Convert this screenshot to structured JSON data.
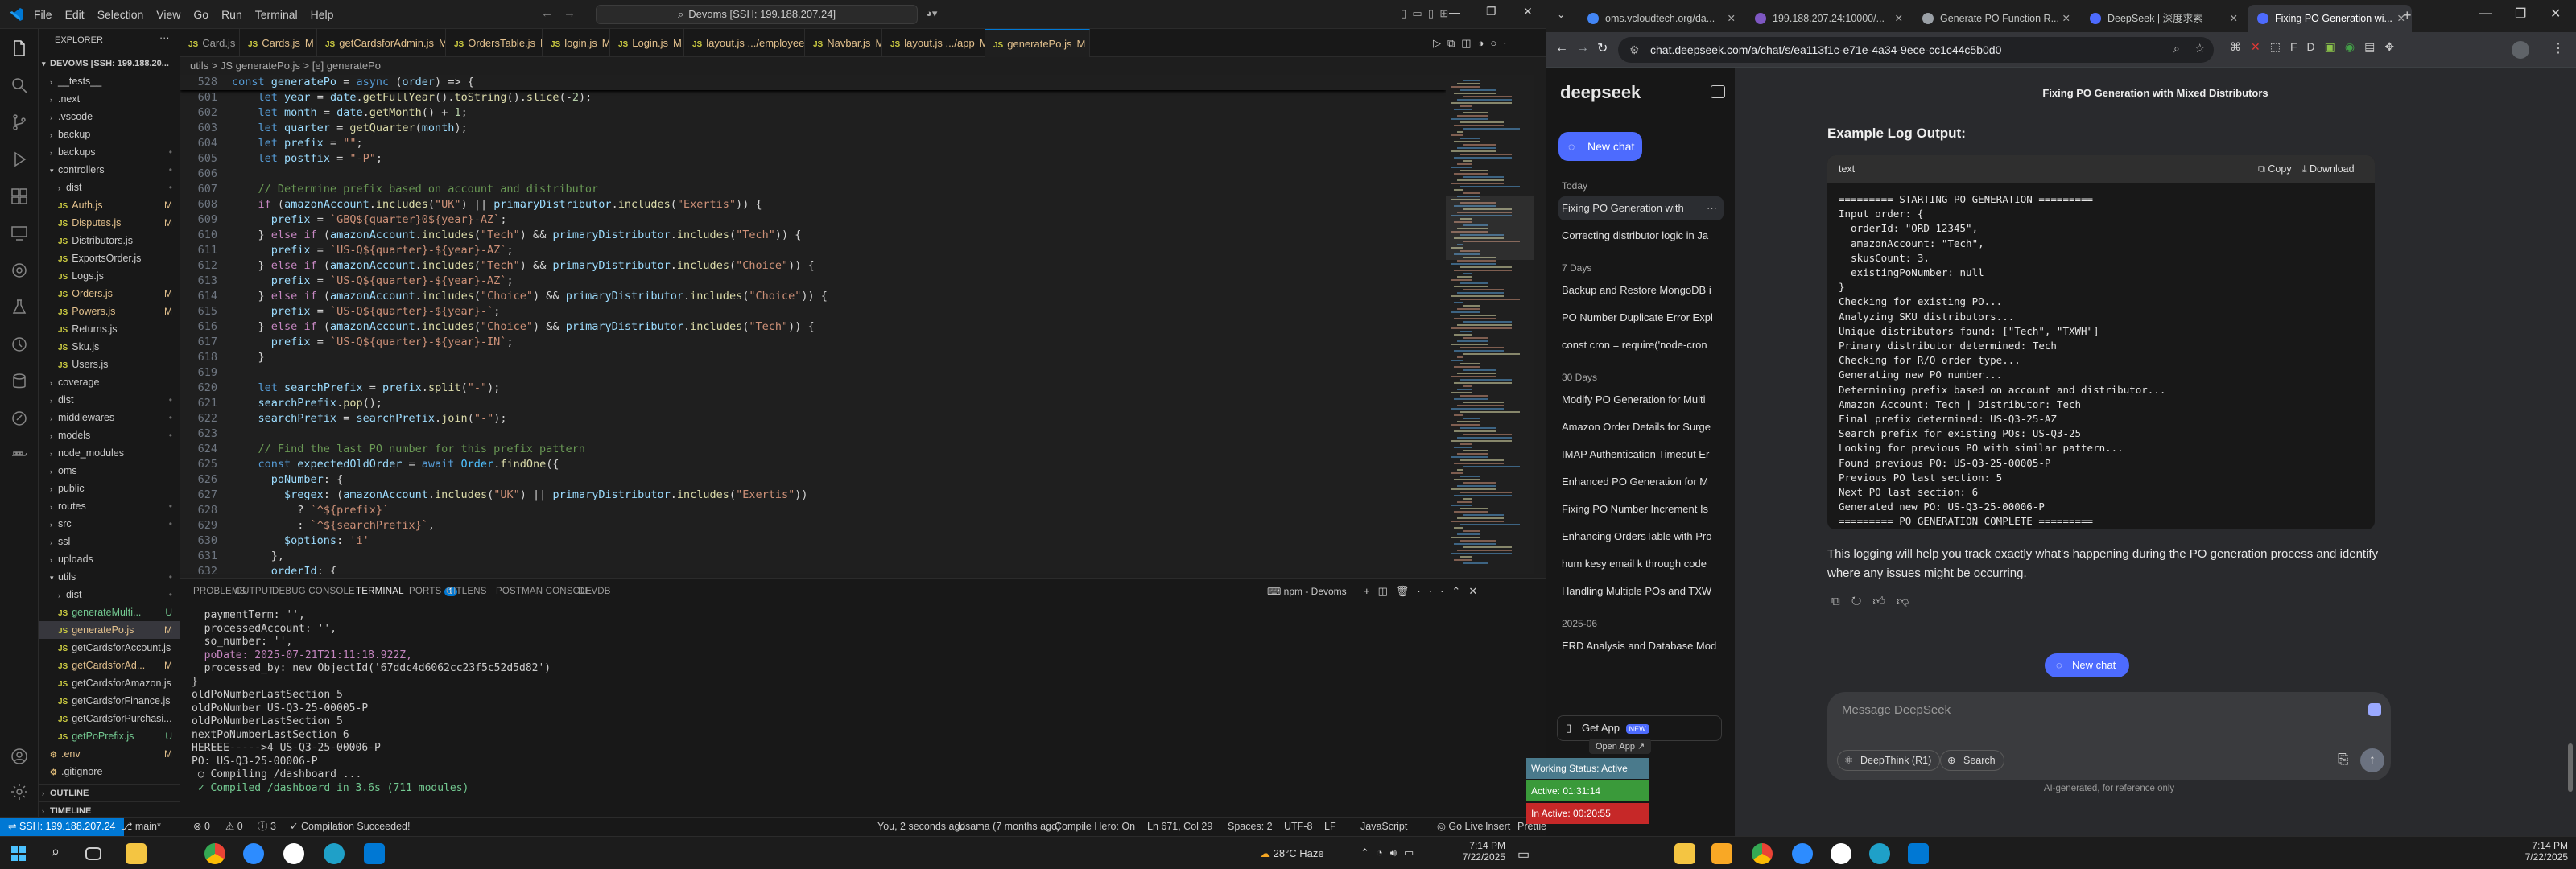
{
  "vscode": {
    "menu": [
      "File",
      "Edit",
      "Selection",
      "View",
      "Go",
      "Run",
      "Terminal",
      "Help"
    ],
    "search": "Devoms [SSH: 199.188.207.24]",
    "explorer_title": "EXPLORER",
    "root": "DEVOMS [SSH: 199.188.20...",
    "tree": [
      {
        "label": "__tests__",
        "type": "folder",
        "depth": 1,
        "open": false,
        "badge": ""
      },
      {
        "label": ".next",
        "type": "folder",
        "depth": 1,
        "open": false,
        "badge": ""
      },
      {
        "label": ".vscode",
        "type": "folder",
        "depth": 1,
        "open": false,
        "badge": ""
      },
      {
        "label": "backup",
        "type": "folder",
        "depth": 1,
        "open": false,
        "badge": ""
      },
      {
        "label": "backups",
        "type": "folder",
        "depth": 1,
        "open": false,
        "badge": "•"
      },
      {
        "label": "controllers",
        "type": "folder",
        "depth": 1,
        "open": true,
        "badge": "•"
      },
      {
        "label": "dist",
        "type": "folder",
        "depth": 2,
        "open": false,
        "badge": "•"
      },
      {
        "label": "Auth.js",
        "type": "js",
        "depth": 2,
        "badge": "M"
      },
      {
        "label": "Disputes.js",
        "type": "js",
        "depth": 2,
        "badge": "M"
      },
      {
        "label": "Distributors.js",
        "type": "js",
        "depth": 2,
        "badge": ""
      },
      {
        "label": "ExportsOrder.js",
        "type": "js",
        "depth": 2,
        "badge": ""
      },
      {
        "label": "Logs.js",
        "type": "js",
        "depth": 2,
        "badge": ""
      },
      {
        "label": "Orders.js",
        "type": "js",
        "depth": 2,
        "badge": "M"
      },
      {
        "label": "Powers.js",
        "type": "js",
        "depth": 2,
        "badge": "M"
      },
      {
        "label": "Returns.js",
        "type": "js",
        "depth": 2,
        "badge": ""
      },
      {
        "label": "Sku.js",
        "type": "js",
        "depth": 2,
        "badge": ""
      },
      {
        "label": "Users.js",
        "type": "js",
        "depth": 2,
        "badge": ""
      },
      {
        "label": "coverage",
        "type": "folder",
        "depth": 1,
        "open": false,
        "badge": ""
      },
      {
        "label": "dist",
        "type": "folder",
        "depth": 1,
        "open": false,
        "badge": "•"
      },
      {
        "label": "middlewares",
        "type": "folder",
        "depth": 1,
        "open": false,
        "badge": "•"
      },
      {
        "label": "models",
        "type": "folder",
        "depth": 1,
        "open": false,
        "badge": "•"
      },
      {
        "label": "node_modules",
        "type": "folder",
        "depth": 1,
        "open": false,
        "badge": ""
      },
      {
        "label": "oms",
        "type": "folder",
        "depth": 1,
        "open": false,
        "badge": ""
      },
      {
        "label": "public",
        "type": "folder",
        "depth": 1,
        "open": false,
        "badge": ""
      },
      {
        "label": "routes",
        "type": "folder",
        "depth": 1,
        "open": false,
        "badge": "•"
      },
      {
        "label": "src",
        "type": "folder",
        "depth": 1,
        "open": false,
        "badge": "•"
      },
      {
        "label": "ssl",
        "type": "folder",
        "depth": 1,
        "open": false,
        "badge": ""
      },
      {
        "label": "uploads",
        "type": "folder",
        "depth": 1,
        "open": false,
        "badge": ""
      },
      {
        "label": "utils",
        "type": "folder",
        "depth": 1,
        "open": true,
        "badge": "•"
      },
      {
        "label": "dist",
        "type": "folder",
        "depth": 2,
        "open": false,
        "badge": "•"
      },
      {
        "label": "generateMulti...",
        "type": "js",
        "depth": 2,
        "badge": "U"
      },
      {
        "label": "generatePo.js",
        "type": "js",
        "depth": 2,
        "badge": "M"
      },
      {
        "label": "getCardsforAccount.js",
        "type": "js",
        "depth": 2,
        "badge": ""
      },
      {
        "label": "getCardsforAd...",
        "type": "js",
        "depth": 2,
        "badge": "M"
      },
      {
        "label": "getCardsforAmazon.js",
        "type": "js",
        "depth": 2,
        "badge": ""
      },
      {
        "label": "getCardsforFinance.js",
        "type": "js",
        "depth": 2,
        "badge": ""
      },
      {
        "label": "getCardsforPurchasi...",
        "type": "js",
        "depth": 2,
        "badge": ""
      },
      {
        "label": "getPoPrefix.js",
        "type": "js",
        "depth": 2,
        "badge": "U"
      },
      {
        "label": ".env",
        "type": "file",
        "depth": 1,
        "badge": "M"
      },
      {
        "label": ".gitignore",
        "type": "file",
        "depth": 1,
        "badge": ""
      }
    ],
    "outline": "OUTLINE",
    "timeline": "TIMELINE",
    "tabs": [
      {
        "label": "Card.js",
        "mod": ""
      },
      {
        "label": "Cards.js",
        "mod": "M"
      },
      {
        "label": "getCardsforAdmin.js",
        "mod": "M"
      },
      {
        "label": "OrdersTable.js",
        "mod": "M"
      },
      {
        "label": "login.js",
        "mod": "M"
      },
      {
        "label": "Login.js",
        "mod": "M"
      },
      {
        "label": "layout.js .../employee",
        "mod": "M"
      },
      {
        "label": "Navbar.js",
        "mod": "M"
      },
      {
        "label": "layout.js .../app",
        "mod": "M"
      },
      {
        "label": "generatePo.js",
        "mod": "M"
      }
    ],
    "breadcrumb": "utils > JS generatePo.js > [e] generatePo",
    "sticky_line": {
      "n": "528",
      "code": "const generatePo = async (order) => {"
    },
    "code": [
      {
        "n": "601",
        "t": "    let year = date.getFullYear().toString().slice(-2);"
      },
      {
        "n": "602",
        "t": "    let month = date.getMonth() + 1;"
      },
      {
        "n": "603",
        "t": "    let quarter = getQuarter(month);"
      },
      {
        "n": "604",
        "t": "    let prefix = \"\";"
      },
      {
        "n": "605",
        "t": "    let postfix = \"-P\";"
      },
      {
        "n": "606",
        "t": ""
      },
      {
        "n": "607",
        "t": "    // Determine prefix based on account and distributor"
      },
      {
        "n": "608",
        "t": "    if (amazonAccount.includes(\"UK\") || primaryDistributor.includes(\"Exertis\")) {"
      },
      {
        "n": "609",
        "t": "      prefix = `GBQ${quarter}0${year}-AZ`;"
      },
      {
        "n": "610",
        "t": "    } else if (amazonAccount.includes(\"Tech\") && primaryDistributor.includes(\"Tech\")) {"
      },
      {
        "n": "611",
        "t": "      prefix = `US-Q${quarter}-${year}-AZ`;"
      },
      {
        "n": "612",
        "t": "    } else if (amazonAccount.includes(\"Tech\") && primaryDistributor.includes(\"Choice\")) {"
      },
      {
        "n": "613",
        "t": "      prefix = `US-Q${quarter}-${year}-AZ`;"
      },
      {
        "n": "614",
        "t": "    } else if (amazonAccount.includes(\"Choice\") && primaryDistributor.includes(\"Choice\")) {"
      },
      {
        "n": "615",
        "t": "      prefix = `US-Q${quarter}-${year}-`;"
      },
      {
        "n": "616",
        "t": "    } else if (amazonAccount.includes(\"Choice\") && primaryDistributor.includes(\"Tech\")) {"
      },
      {
        "n": "617",
        "t": "      prefix = `US-Q${quarter}-${year}-IN`;"
      },
      {
        "n": "618",
        "t": "    }"
      },
      {
        "n": "619",
        "t": ""
      },
      {
        "n": "620",
        "t": "    let searchPrefix = prefix.split(\"-\");"
      },
      {
        "n": "621",
        "t": "    searchPrefix.pop();"
      },
      {
        "n": "622",
        "t": "    searchPrefix = searchPrefix.join(\"-\");"
      },
      {
        "n": "623",
        "t": ""
      },
      {
        "n": "624",
        "t": "    // Find the last PO number for this prefix pattern"
      },
      {
        "n": "625",
        "t": "    const expectedOldOrder = await Order.findOne({"
      },
      {
        "n": "626",
        "t": "      poNumber: {"
      },
      {
        "n": "627",
        "t": "        $regex: (amazonAccount.includes(\"UK\") || primaryDistributor.includes(\"Exertis\"))"
      },
      {
        "n": "628",
        "t": "          ? `^${prefix}`"
      },
      {
        "n": "629",
        "t": "          : `^${searchPrefix}`,"
      },
      {
        "n": "630",
        "t": "        $options: 'i'"
      },
      {
        "n": "631",
        "t": "      },"
      },
      {
        "n": "632",
        "t": "      orderId: {"
      }
    ],
    "panel_tabs": [
      "PROBLEMS",
      "OUTPUT",
      "DEBUG CONSOLE",
      "TERMINAL",
      "PORTS",
      "GITLENS",
      "POSTMAN CONSOLE",
      "DEVDB"
    ],
    "ports_count": "1",
    "terminal_name": "npm - Devoms",
    "terminal": [
      "  paymentTerm: '',",
      "  processedAccount: '',",
      "  so_number: '',",
      "  poDate: 2025-07-21T21:11:18.922Z,",
      "  processed_by: new ObjectId('67ddc4d6062cc23f5c52d5d82')",
      "}",
      "oldPoNumberLastSection 5",
      "oldPoNumber US-Q3-25-00005-P",
      "oldPoNumberLastSection 5",
      "nextPoNumberLastSection 6",
      "HEREEE----->4 US-Q3-25-00006-P",
      "PO: US-Q3-25-00006-P",
      " ○ Compiling /dashboard ...",
      " ✓ Compiled /dashboard in 3.6s (711 modules)"
    ],
    "status": {
      "remote": "SSH: 199.188.207.24",
      "branch": "main*",
      "errors": "0",
      "warnings": "0",
      "info": "3",
      "compilation": "Compilation Succeeded!",
      "blame": "You, 2 seconds ago",
      "author": "Usama (7 months ago)",
      "compile_hero": "Compile Hero: On",
      "position": "Ln 671, Col 29",
      "spaces": "Spaces: 2",
      "encoding": "UTF-8",
      "eol": "LF",
      "language": "JavaScript",
      "golive": "Go Live",
      "insert": "Insert",
      "prettier1": "Prettier",
      "prettier2": "Prettier"
    }
  },
  "browser": {
    "tabs": [
      {
        "label": "oms.vcloudtech.org/da...",
        "color": "#4285f4",
        "active": false
      },
      {
        "label": "199.188.207.24:10000/...",
        "color": "#7e57c2",
        "active": false
      },
      {
        "label": "Generate PO Function R...",
        "color": "#9aa0a6",
        "active": false
      },
      {
        "label": "DeepSeek | 深度求索",
        "color": "#4d6bfe",
        "active": false
      },
      {
        "label": "Fixing PO Generation wi...",
        "color": "#4d6bfe",
        "active": true
      }
    ],
    "url": "chat.deepseek.com/a/chat/s/ea113f1c-e71e-4a34-9ece-cc1c44c5b0d0"
  },
  "deepseek": {
    "logo": "deepseek",
    "new_chat": "New chat",
    "sections": [
      {
        "title": "Today",
        "items": [
          "Fixing PO Generation with",
          "Correcting distributor logic in Ja"
        ]
      },
      {
        "title": "7 Days",
        "items": [
          "Backup and Restore MongoDB i",
          "PO Number Duplicate Error Expl",
          "const cron = require('node-cron"
        ]
      },
      {
        "title": "30 Days",
        "items": [
          "Modify PO Generation for Multi",
          "Amazon Order Details for Surge",
          "IMAP Authentication Timeout Er",
          "Enhanced PO Generation for M",
          "Fixing PO Number Increment Is",
          "Enhancing OrdersTable with Pro",
          "hum kesy email k through code",
          "Handling Multiple POs and TXW"
        ]
      },
      {
        "title": "2025-06",
        "items": [
          "ERD Analysis and Database Mod"
        ]
      }
    ],
    "get_app": "Get App",
    "new_badge": "NEW",
    "open_app": "Open App ↗",
    "chat_title": "Fixing PO Generation with Mixed Distributors",
    "heading": "Example Log Output:",
    "code_lang": "text",
    "copy": "Copy",
    "download": "Download",
    "log": [
      "========= STARTING PO GENERATION =========",
      "Input order: {",
      "  orderId: \"ORD-12345\",",
      "  amazonAccount: \"Tech\",",
      "  skusCount: 3,",
      "  existingPoNumber: null",
      "}",
      "Checking for existing PO...",
      "Analyzing SKU distributors...",
      "Unique distributors found: [\"Tech\", \"TXWH\"]",
      "Primary distributor determined: Tech",
      "Checking for R/O order type...",
      "Generating new PO number...",
      "Determining prefix based on account and distributor...",
      "Amazon Account: Tech | Distributor: Tech",
      "Final prefix determined: US-Q3-25-AZ",
      "Search prefix for existing POs: US-Q3-25",
      "Looking for previous PO with similar pattern...",
      "Found previous PO: US-Q3-25-00005-P",
      "Previous PO last section: 5",
      "Next PO last section: 6",
      "Generated new PO: US-Q3-25-00006-P",
      "========= PO GENERATION COMPLETE ========="
    ],
    "paragraph": "This logging will help you track exactly what's happening during the PO generation process and identify where any issues might be occurring.",
    "new_chat_btn": "New chat",
    "input_placeholder": "Message DeepSeek",
    "deepthink": "DeepThink (R1)",
    "search_btn": "Search",
    "footer": "AI-generated, for reference only"
  },
  "overlay": {
    "working": "Working Status: Active",
    "active": "Active: 01:31:14",
    "inactive": "In Active: 00:20:55"
  },
  "taskbar": {
    "weather": "28°C Haze",
    "left_time": "7:14 PM",
    "left_date": "7/22/2025",
    "right_time": "7:14 PM",
    "right_date": "7/22/2025"
  }
}
